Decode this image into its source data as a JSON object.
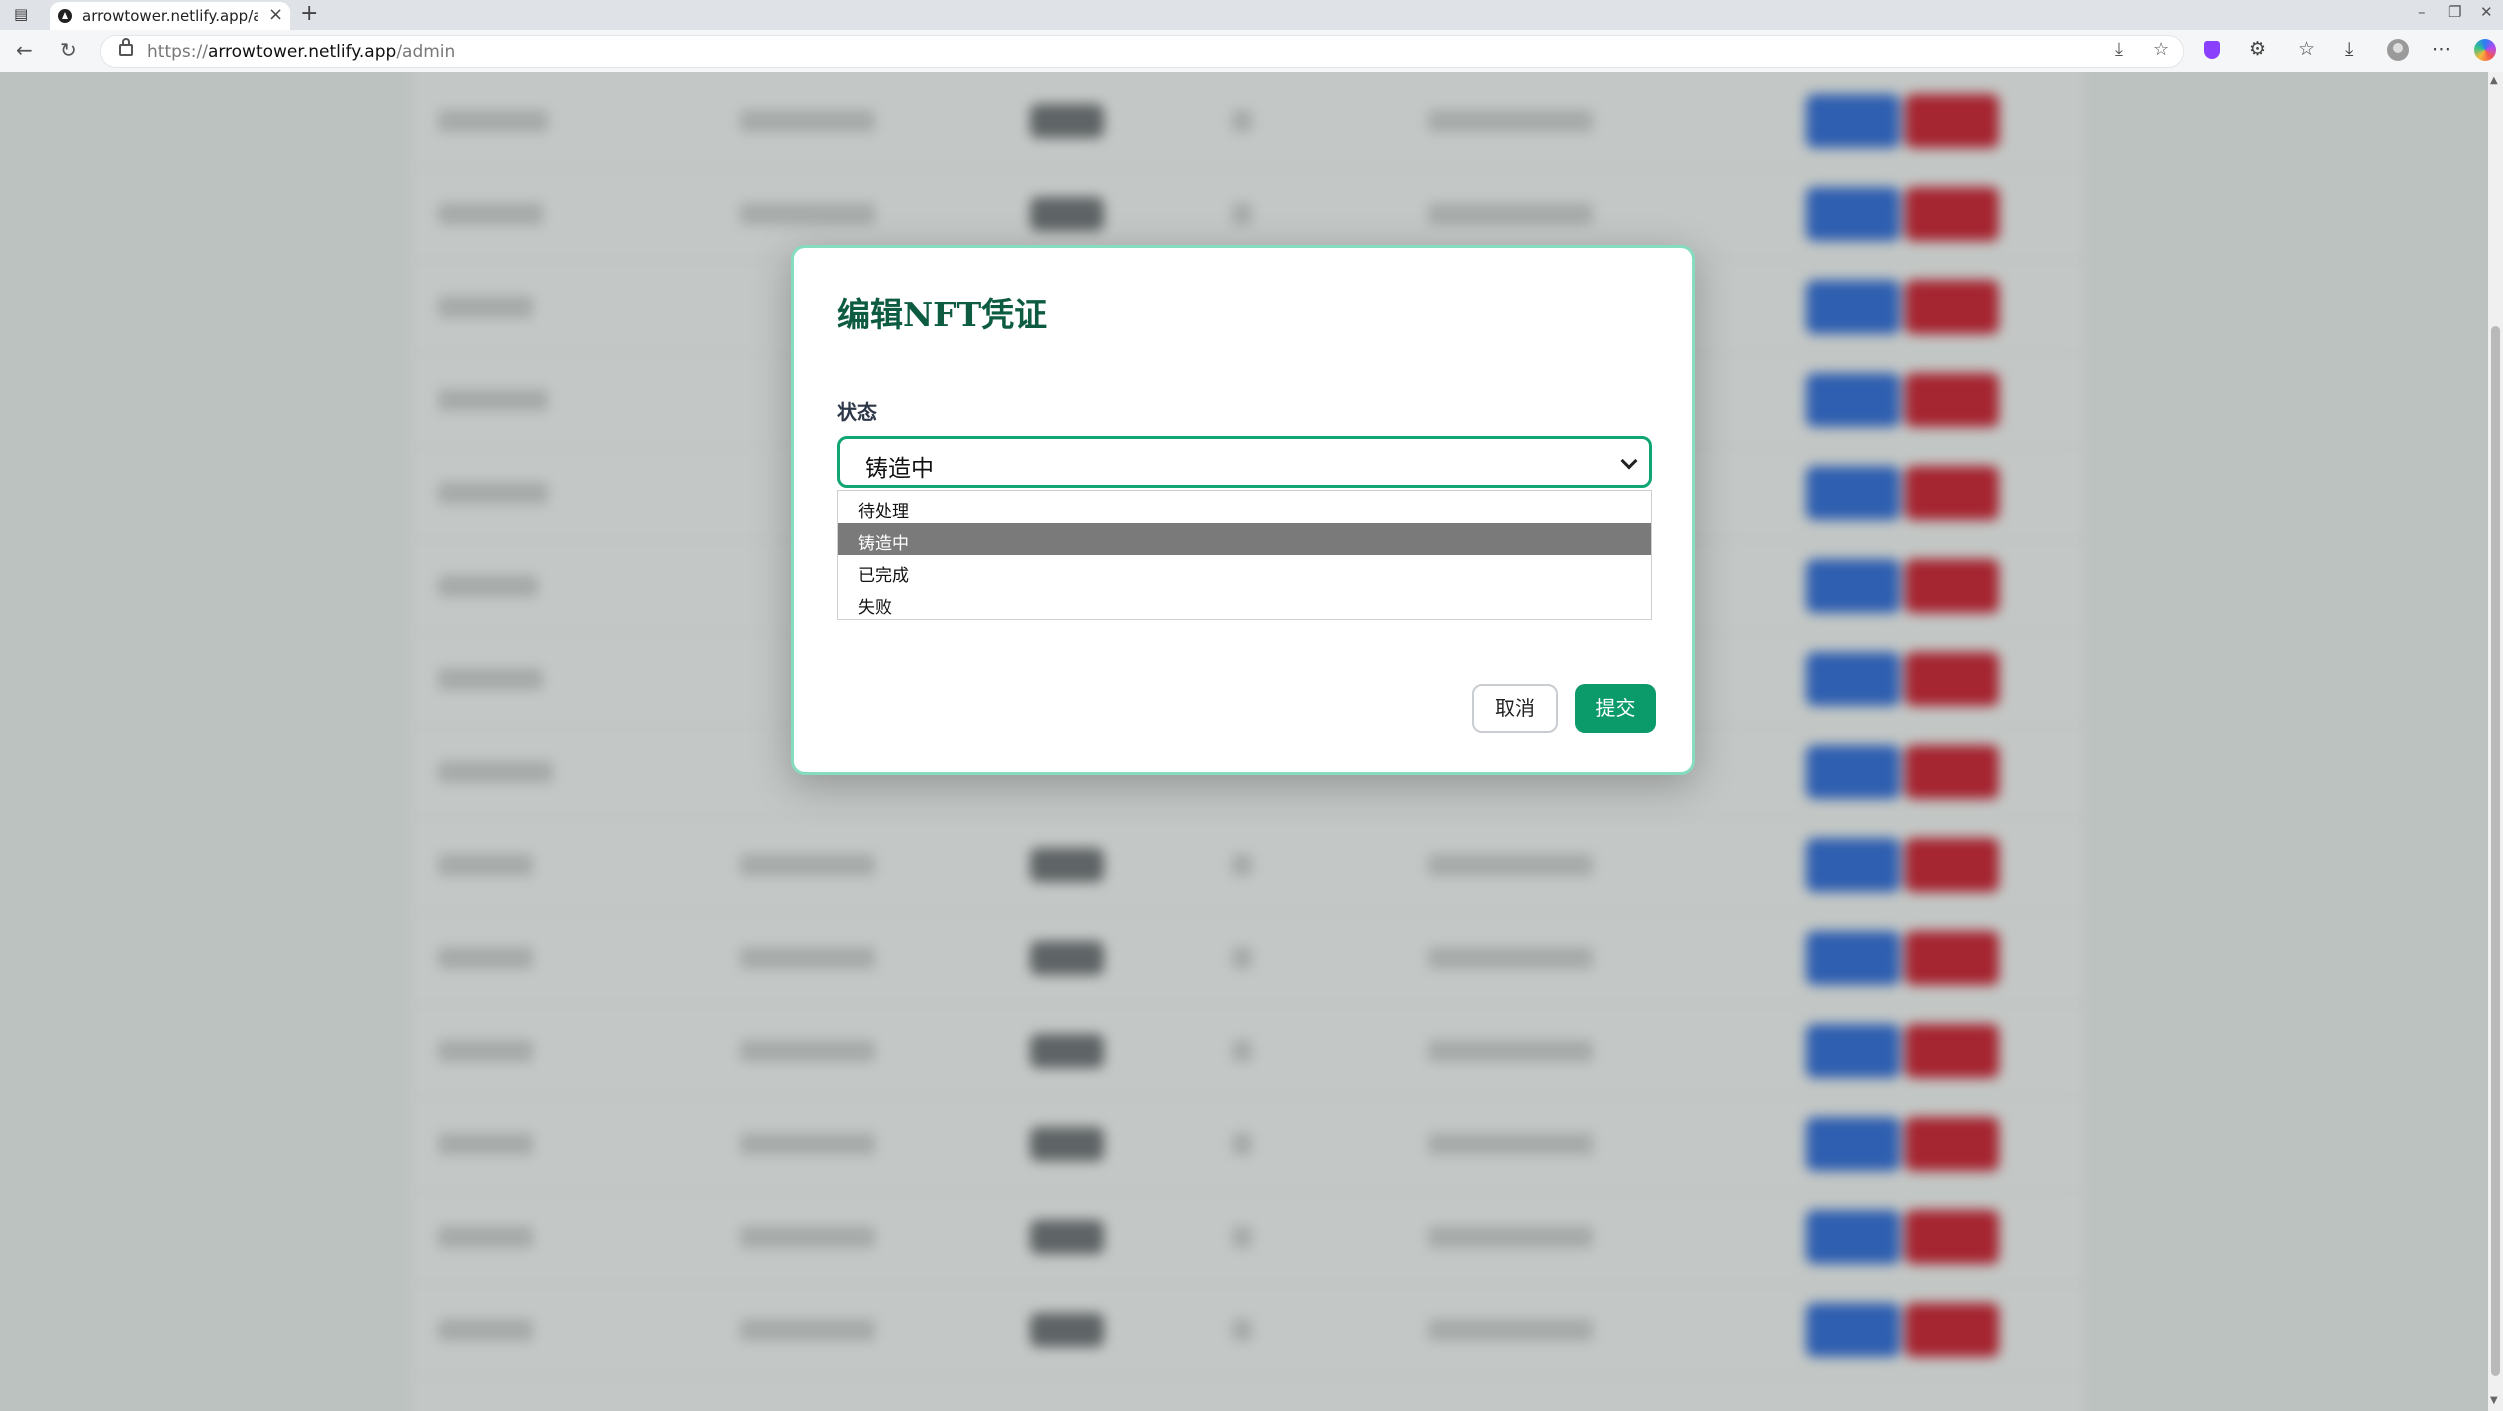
{
  "browser": {
    "tab_title": "arrowtower.netlify.app/ad",
    "url_scheme": "https://",
    "url_host": "arrowtower.netlify.app",
    "url_path": "/admin"
  },
  "modal": {
    "title": "编辑NFT凭证",
    "status_label": "状态",
    "status_value": "铸造中",
    "status_options": [
      "待处理",
      "铸造中",
      "已完成",
      "失败"
    ],
    "selected_index": 1,
    "cancel_label": "取消",
    "submit_label": "提交"
  }
}
